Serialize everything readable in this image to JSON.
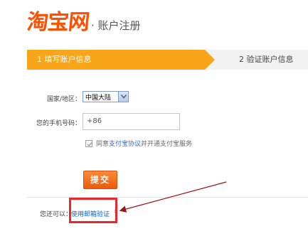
{
  "header": {
    "logo_text": "淘宝网",
    "subtitle": "· 账户注册"
  },
  "steps": {
    "step1_label": "1 填写账户信息",
    "step2_label": "2 验证账户信息"
  },
  "form": {
    "country_label": "国家/地区：",
    "country_value": "中国大陆",
    "phone_label": "您的手机号码：",
    "phone_prefix": "+86",
    "agree_prefix": "同意",
    "agree_link": "支付宝协议",
    "agree_suffix": "并开通支付宝服务",
    "submit_label": "提交"
  },
  "alternative": {
    "label": "您还可以：",
    "link": "使用邮箱验证",
    "chevron": "›"
  },
  "colors": {
    "brand": "#ff5000",
    "step_active": "#f8a51a",
    "highlight": "#e8282a",
    "link": "#0066cc"
  }
}
